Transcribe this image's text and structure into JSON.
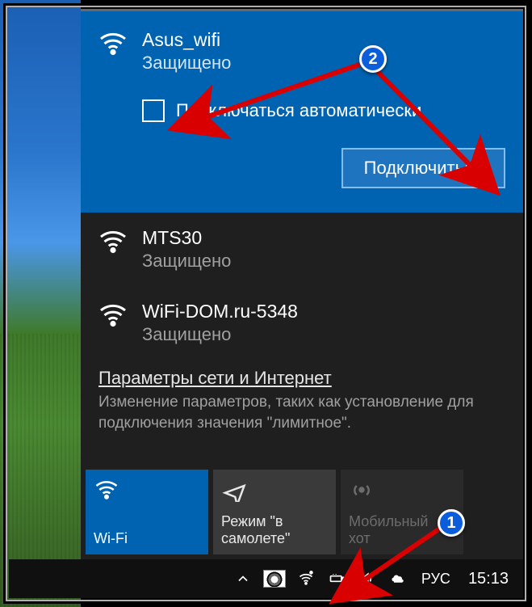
{
  "selected_network": {
    "name": "Asus_wifi",
    "status": "Защищено",
    "auto_connect_label": "Подключаться автоматически",
    "connect_label": "Подключиться"
  },
  "networks": [
    {
      "name": "MTS30",
      "status": "Защищено"
    },
    {
      "name": "WiFi-DOM.ru-5348",
      "status": "Защищено"
    }
  ],
  "settings": {
    "link": "Параметры сети и Интернет",
    "desc": "Изменение параметров, таких как установление для подключения значения \"лимитное\"."
  },
  "tiles": {
    "wifi": "Wi-Fi",
    "airplane_line1": "Режим \"в",
    "airplane_line2": "самолете\"",
    "hotspot_line1": "Мобильный",
    "hotspot_line2": "хот"
  },
  "taskbar": {
    "lang": "РУС",
    "time": "15:13"
  },
  "annotations": {
    "badge1": "1",
    "badge2": "2"
  }
}
